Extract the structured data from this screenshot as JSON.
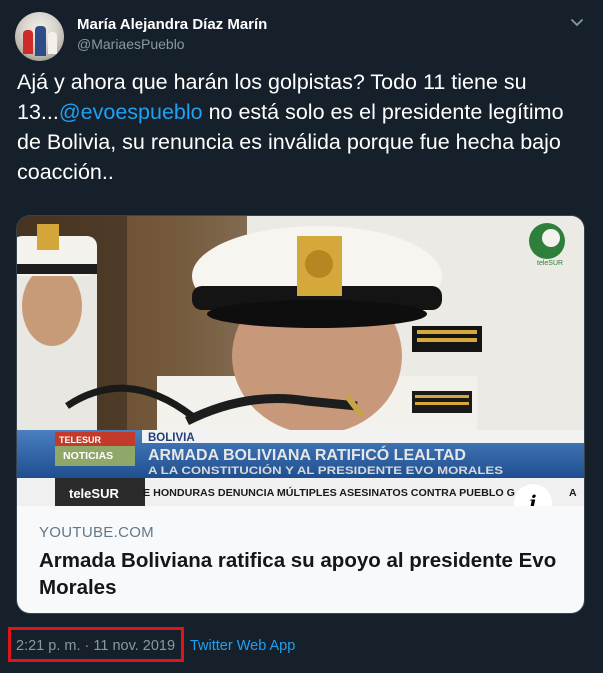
{
  "tweet": {
    "author_name": "María Alejandra Díaz Marín",
    "author_handle": "@MariaesPueblo",
    "text_part1": "Ajá y ahora que harán los golpistas? Todo 11 tiene su 13...",
    "mention": "@evoespueblo",
    "text_part2": " no está solo es el presidente legítimo de Bolivia, su renuncia es inválida porque fue hecha bajo coacción..",
    "timestamp": "2:21 p. m. · 11 nov. 2019",
    "source_app": "Twitter Web App"
  },
  "card": {
    "domain": "YOUTUBE.COM",
    "title": "Armada Boliviana ratifica su apoyo al presidente Evo Morales",
    "info_label": "i",
    "video": {
      "region_label": "BOLIVIA",
      "headline": "ARMADA BOLIVIANA RATIFICÓ LEALTAD",
      "subheadline": "A LA CONSTITUCIÓN Y AL PRESIDENTE EVO MORALES",
      "badge_top": "TELESUR",
      "badge_bottom": "NOTICIAS",
      "ticker": "E HONDURAS DENUNCIA MÚLTIPLES ASESINATOS CONTRA PUEBLO G",
      "ticker_fragment_right": "A",
      "channel": "teleSUR",
      "watermark": "teleSUR"
    }
  },
  "colors": {
    "background": "#15202b",
    "accent": "#1da1f2",
    "muted": "#8899a6",
    "highlight_box": "#e0141b"
  },
  "icons": {
    "menu": "chevron-down-icon",
    "info": "info-icon"
  }
}
